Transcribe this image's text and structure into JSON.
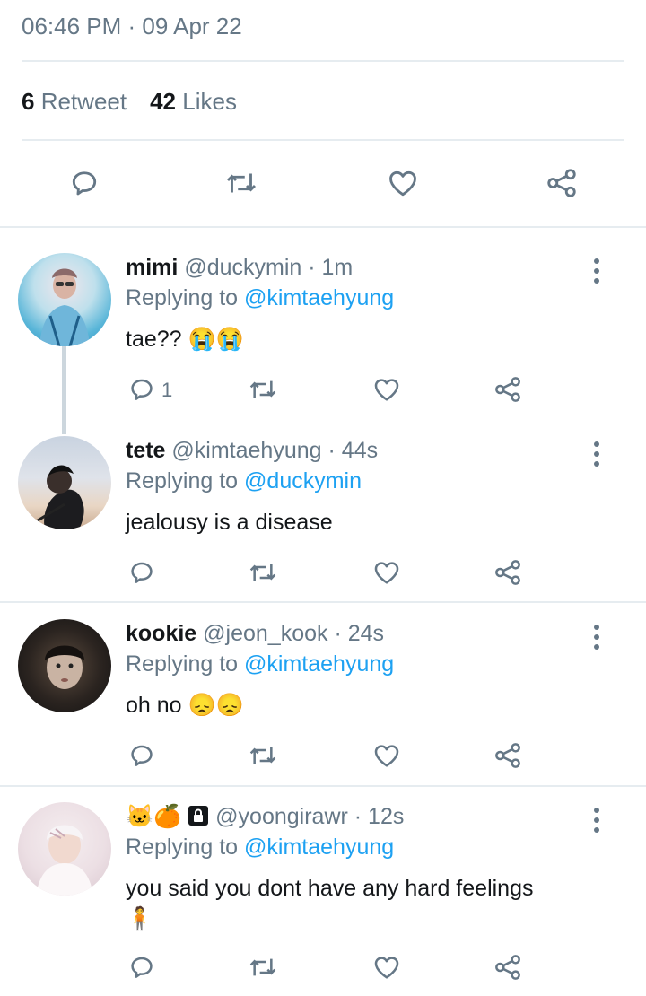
{
  "tweet": {
    "timestamp": "06:46 PM · 09 Apr 22",
    "retweet_count": "6",
    "retweet_label": "Retweet",
    "likes_count": "42",
    "likes_label": "Likes"
  },
  "icons": {
    "reply": "reply-icon",
    "retweet": "retweet-icon",
    "like": "heart-icon",
    "share": "share-icon",
    "more": "more-options-icon"
  },
  "colors": {
    "link_blue": "#1da1f2",
    "secondary_text": "#657786",
    "icon_gray": "#657786",
    "divider": "#e6ecf0",
    "thread_line": "#ccd6dd"
  },
  "replies": [
    {
      "display_name": "mimi",
      "handle": "@duckymin",
      "time": "· 1m",
      "replying_prefix": "Replying to",
      "replying_to": "@kimtaehyung",
      "text": "tae??",
      "emoji": "😭😭",
      "reply_count": "1"
    },
    {
      "display_name": "tete",
      "handle": "@kimtaehyung",
      "time": "· 44s",
      "replying_prefix": "Replying to",
      "replying_to": "@duckymin",
      "text": "jealousy is a disease"
    },
    {
      "display_name": "kookie",
      "handle": "@jeon_kook",
      "time": "· 24s",
      "replying_prefix": "Replying to",
      "replying_to": "@kimtaehyung",
      "text": "oh no",
      "emoji": "😞😞"
    },
    {
      "display_name_emoji": "🐱🍊",
      "locked": true,
      "handle": "@yoongirawr",
      "time": "· 12s",
      "replying_prefix": "Replying to",
      "replying_to": "@kimtaehyung",
      "text": "you said you dont have any hard feelings",
      "text_line2_emoji": "🧍"
    }
  ]
}
